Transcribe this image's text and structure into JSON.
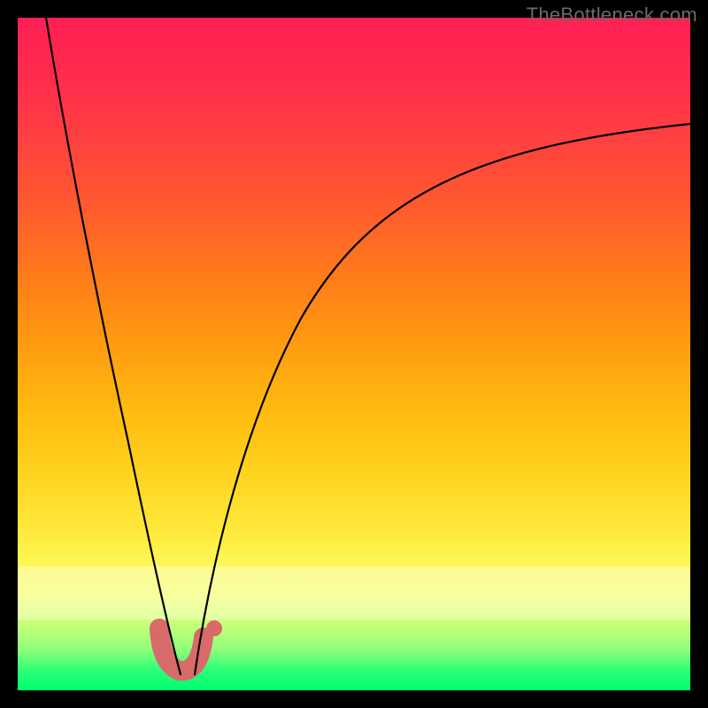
{
  "watermark": {
    "text": "TheBottleneck.com"
  },
  "chart_data": {
    "type": "line",
    "title": "",
    "xlabel": "",
    "ylabel": "",
    "xlim": [
      0,
      100
    ],
    "ylim": [
      0,
      100
    ],
    "grid": false,
    "legend": false,
    "background_gradient": {
      "direction": "top-to-bottom",
      "stops": [
        {
          "pos": 0,
          "color": "#ff1f55"
        },
        {
          "pos": 50,
          "color": "#ff9a10"
        },
        {
          "pos": 82,
          "color": "#fff95a"
        },
        {
          "pos": 100,
          "color": "#00ff70"
        }
      ]
    },
    "series": [
      {
        "name": "left-curve",
        "type": "line",
        "x": [
          4,
          6,
          8,
          10,
          12,
          14,
          16,
          18,
          20,
          22,
          23.5
        ],
        "y": [
          100,
          94,
          85,
          75,
          64,
          53,
          42,
          31,
          20,
          10,
          2
        ],
        "stroke": "#000000",
        "stroke_width": 2
      },
      {
        "name": "right-curve",
        "type": "line",
        "x": [
          25,
          27,
          30,
          34,
          39,
          45,
          52,
          60,
          70,
          82,
          95,
          100
        ],
        "y": [
          2,
          12,
          25,
          38,
          49,
          58,
          65,
          71,
          76,
          80,
          83,
          84
        ],
        "stroke": "#000000",
        "stroke_width": 2
      },
      {
        "name": "valley-marker",
        "type": "line",
        "x": [
          20.5,
          21,
          22,
          23,
          24.3,
          25.5,
          26.3,
          27
        ],
        "y": [
          9,
          6,
          3,
          2,
          2.5,
          4.5,
          7,
          10
        ],
        "stroke": "#d86a6a",
        "stroke_width": 18
      }
    ]
  }
}
